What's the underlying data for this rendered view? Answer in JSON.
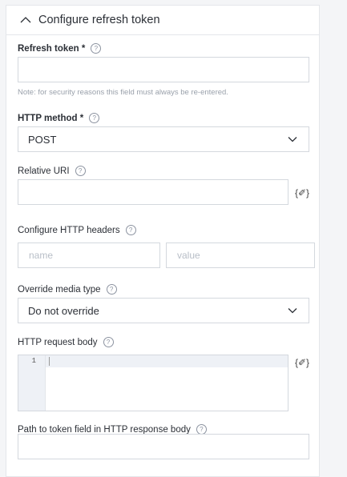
{
  "section": {
    "title": "Configure refresh token"
  },
  "refresh_token": {
    "label": "Refresh token *",
    "value": "",
    "note": "Note: for security reasons this field must always be re-entered."
  },
  "http_method": {
    "label": "HTTP method *",
    "selected": "POST"
  },
  "relative_uri": {
    "label": "Relative URI",
    "value": "",
    "expression_button": "{✐}"
  },
  "http_headers": {
    "label": "Configure HTTP headers",
    "name_placeholder": "name",
    "value_placeholder": "value"
  },
  "media_type": {
    "label": "Override media type",
    "selected": "Do not override"
  },
  "request_body": {
    "label": "HTTP request body",
    "line_number": "1",
    "expression_button": "{✐}"
  },
  "token_path": {
    "label": "Path to token field in HTTP response body",
    "value": ""
  },
  "help_glyph": "?",
  "icons": {
    "collapse": "chevron-up-icon",
    "dropdown": "chevron-down-icon",
    "help": "help-circle-icon",
    "expression": "expression-edit-icon"
  }
}
